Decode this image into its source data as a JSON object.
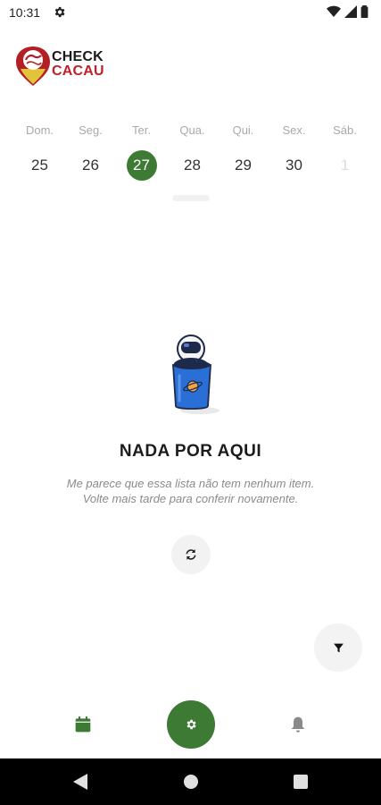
{
  "status": {
    "time": "10:31"
  },
  "app": {
    "logo_line1": "CHECK",
    "logo_line2": "CACAU"
  },
  "week": {
    "days": [
      {
        "name": "Dom.",
        "number": "25"
      },
      {
        "name": "Seg.",
        "number": "26"
      },
      {
        "name": "Ter.",
        "number": "27",
        "selected": true
      },
      {
        "name": "Qua.",
        "number": "28"
      },
      {
        "name": "Qui.",
        "number": "29"
      },
      {
        "name": "Sex.",
        "number": "30"
      },
      {
        "name": "Sáb.",
        "number": "1",
        "muted": true
      }
    ]
  },
  "empty_state": {
    "title": "NADA POR AQUI",
    "description_line1": "Me parece que essa lista não tem nenhum item.",
    "description_line2": "Volte mais tarde para conferir novamente."
  },
  "icons": {
    "refresh": "refresh-icon",
    "filter": "filter-icon",
    "calendar": "calendar-icon",
    "settings": "gear-icon",
    "notifications": "bell-icon"
  },
  "colors": {
    "accent": "#3d7a34",
    "brand_red": "#c0202a",
    "brand_yellow": "#e2c33a"
  }
}
